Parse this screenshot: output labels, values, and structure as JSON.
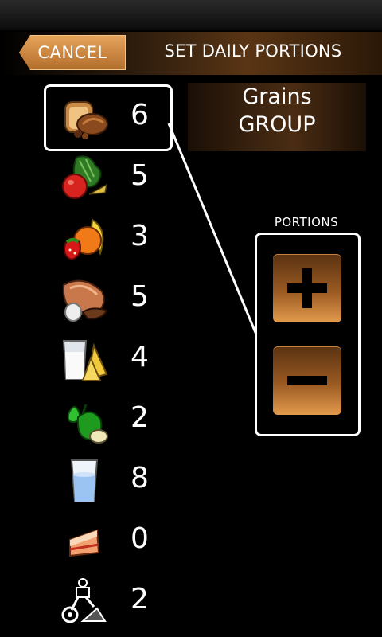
{
  "header": {
    "cancel_label": "CANCEL",
    "title": "SET DAILY PORTIONS"
  },
  "selected_group": {
    "line1": "Grains",
    "line2": "GROUP"
  },
  "portions": {
    "label": "PORTIONS",
    "plus_icon": "plus-icon",
    "minus_icon": "minus-icon"
  },
  "food_groups": [
    {
      "icon": "bread-icon",
      "count": "6",
      "selected": true
    },
    {
      "icon": "vegetables-icon",
      "count": "5"
    },
    {
      "icon": "fruits-icon",
      "count": "3"
    },
    {
      "icon": "meat-icon",
      "count": "5"
    },
    {
      "icon": "dairy-icon",
      "count": "4"
    },
    {
      "icon": "oils-icon",
      "count": "2"
    },
    {
      "icon": "water-icon",
      "count": "8"
    },
    {
      "icon": "sweets-icon",
      "count": "0"
    },
    {
      "icon": "exercise-icon",
      "count": "2"
    }
  ],
  "colors": {
    "accent": "#c97a35",
    "background": "#000000"
  }
}
